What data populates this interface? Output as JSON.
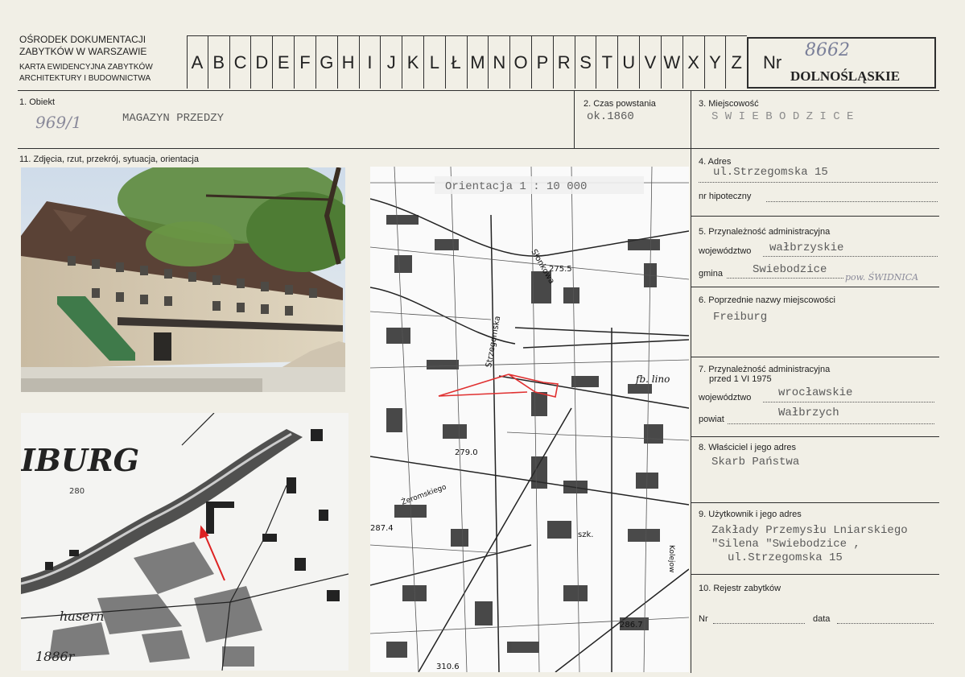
{
  "header": {
    "line1": "OŚRODEK DOKUMENTACJI",
    "line2": "ZABYTKÓW W WARSZAWIE",
    "line3": "KARTA EWIDENCYJNA ZABYTKÓW",
    "line4": "ARCHITEKTURY I BUDOWNICTWA",
    "letters": [
      "A",
      "B",
      "C",
      "D",
      "E",
      "F",
      "G",
      "H",
      "I",
      "J",
      "K",
      "L",
      "Ł",
      "M",
      "N",
      "O",
      "P",
      "R",
      "S",
      "T",
      "U",
      "V",
      "W",
      "X",
      "Y",
      "Z"
    ],
    "nr_label": "Nr",
    "nr_value": "8662",
    "region": "DOLNOŚLĄSKIE"
  },
  "fields": {
    "f1_label": "1. Obiekt",
    "f1_hand": "969/1",
    "f1_value": "MAGAZYN PRZEDZY",
    "f2_label": "2. Czas powstania",
    "f2_value": "ok.1860",
    "f3_label": "3. Miejscowość",
    "f3_value": "S W I E B O D Z I C E",
    "f11_label": "11. Zdjęcia, rzut, przekrój, sytuacja, orientacja",
    "f4_label": "4. Adres",
    "f4_value": "ul.Strzegomska 15",
    "f4_sub": "nr hipoteczny",
    "f5_label": "5. Przynależność administracyjna",
    "f5_woj_label": "województwo",
    "f5_woj_value": "wałbrzyskie",
    "f5_gmina_label": "gmina",
    "f5_gmina_value": "Swiebodzice",
    "f5_hand": "pow. ŚWIDNICA",
    "f6_label": "6. Poprzednie nazwy miejscowości",
    "f6_value": "Freiburg",
    "f7_label": "7. Przynależność administracyjna",
    "f7_label2": "przed 1 VI 1975",
    "f7_woj_label": "województwo",
    "f7_woj_value": "wrocławskie",
    "f7_pow_label": "powiat",
    "f7_pow_value": "Wałbrzych",
    "f8_label": "8. Właściciel i jego adres",
    "f8_value": "Skarb Państwa",
    "f9_label": "9. Użytkownik i jego adres",
    "f9_line1": "Zakłady Przemysłu Lniarskiego",
    "f9_line2": "\"Silena \"Swiebodzice ,",
    "f9_line3": "ul.Strzegomska 15",
    "f10_label": "10. Rejestr zabytków",
    "f10_nr": "Nr",
    "f10_data": "data"
  },
  "maps": {
    "orientation_label": "Orientacja 1 : 10 000",
    "old_map_town": "IBURG",
    "old_map_year": "1886r",
    "old_map_num": "280",
    "old_map_place": "hasern",
    "new_map_labels": [
      "Słonkowa",
      "275.5",
      "fb. lino",
      "Strzegomska",
      "279.0",
      "287.4",
      "Żeromskiego",
      "szk.",
      "286.7",
      "310.6",
      "Kolejow"
    ]
  }
}
